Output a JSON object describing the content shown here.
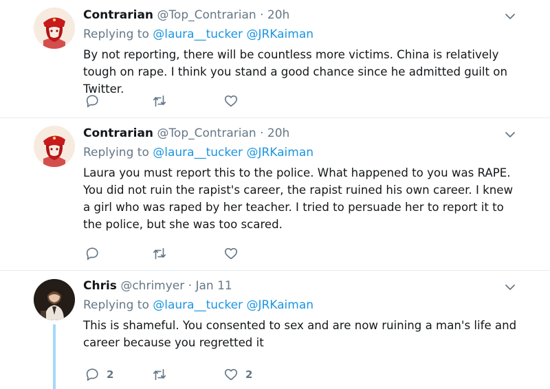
{
  "tweets": [
    {
      "name": "Contrarian",
      "handle": "@Top_Contrarian",
      "separator": "·",
      "time": "20h",
      "replying_prefix": "Replying to",
      "mention1": "@laura__tucker",
      "mention2": "@JRKaiman",
      "text": "By not reporting, there will be countless more victims. China is relatively tough on rape. I think you stand a good chance since he admitted guilt on Twitter.",
      "reply_count": "",
      "like_count": ""
    },
    {
      "name": "Contrarian",
      "handle": "@Top_Contrarian",
      "separator": "·",
      "time": "20h",
      "replying_prefix": "Replying to",
      "mention1": "@laura__tucker",
      "mention2": "@JRKaiman",
      "text": "Laura you must report this to the police. What happened to you was RAPE. You did not ruin the rapist's career, the rapist ruined his own career. I knew a girl who was raped by her teacher. I tried to persuade her to report it to the police, but she was too scared.",
      "reply_count": "",
      "like_count": ""
    },
    {
      "name": "Chris",
      "handle": "@chrimyer",
      "separator": "·",
      "time": "Jan 11",
      "replying_prefix": "Replying to",
      "mention1": "@laura__tucker",
      "mention2": "@JRKaiman",
      "text": "This is shameful. You consented to sex and are now ruining a man's life and career because you regretted it",
      "reply_count": "2",
      "like_count": "2"
    }
  ],
  "icons": {
    "reply": "reply-icon",
    "retweet": "retweet-icon",
    "like": "heart-icon",
    "more": "chevron-down-icon"
  },
  "colors": {
    "link": "#1b95e0",
    "muted": "#657786",
    "thread_line": "#a4d9f9"
  }
}
